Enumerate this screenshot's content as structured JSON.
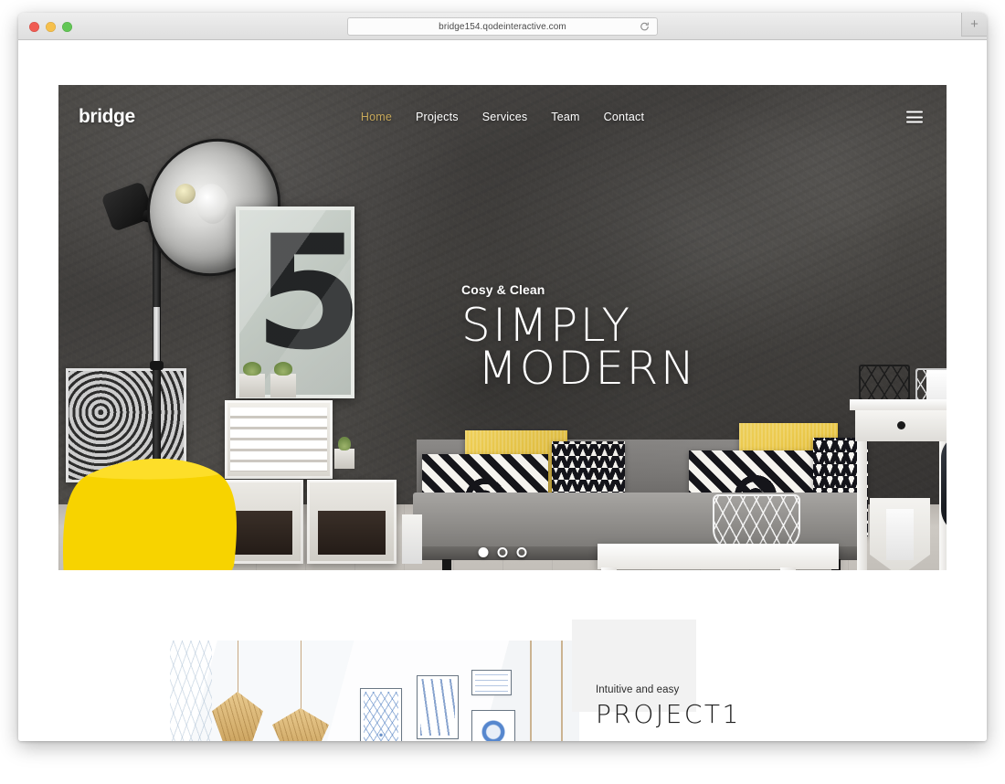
{
  "browser": {
    "url": "bridge154.qodeinteractive.com",
    "reload_icon": "reload-icon",
    "newtab_label": "+",
    "traffic_lights": [
      "close",
      "minimize",
      "zoom"
    ]
  },
  "site": {
    "logo": "bridge",
    "nav": [
      {
        "label": "Home",
        "active": true
      },
      {
        "label": "Projects",
        "active": false
      },
      {
        "label": "Services",
        "active": false
      },
      {
        "label": "Team",
        "active": false
      },
      {
        "label": "Contact",
        "active": false
      }
    ],
    "menu_icon": "hamburger-icon",
    "accent_color": "#c8a95a"
  },
  "hero": {
    "subtitle": "Cosy & Clean",
    "title_line1": "SIMPLY",
    "title_line2": "MODERN",
    "slides": [
      {
        "index": 1,
        "active": true
      },
      {
        "index": 2,
        "active": false
      },
      {
        "index": 3,
        "active": false
      }
    ]
  },
  "project": {
    "subtitle": "Intuitive and easy",
    "title": "PROJECT1"
  }
}
